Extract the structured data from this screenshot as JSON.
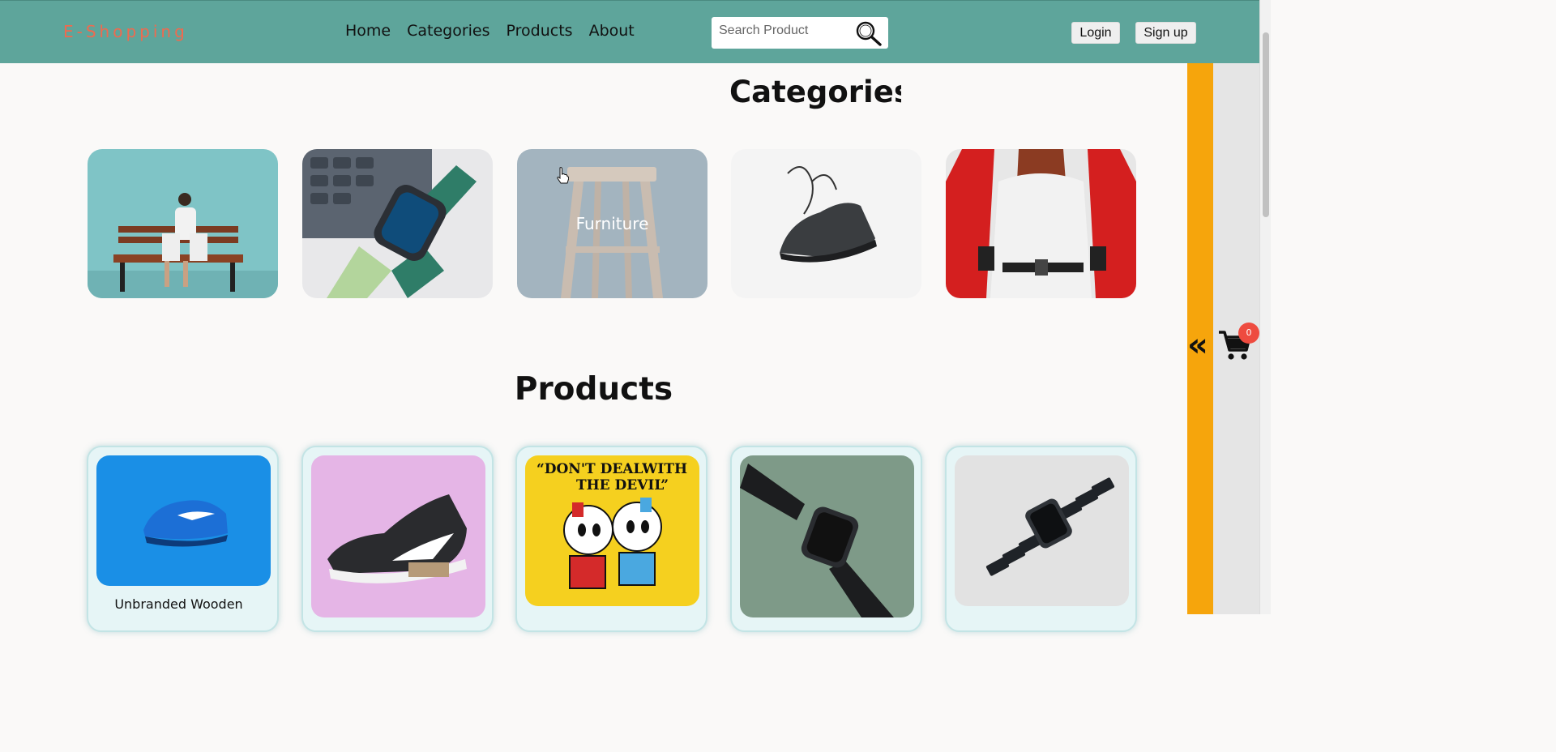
{
  "header": {
    "brand": "E-Shopping",
    "nav": [
      "Home",
      "Categories",
      "Products",
      "About"
    ],
    "search_placeholder": "Search Product",
    "login_label": "Login",
    "signup_label": "Sign up"
  },
  "categories_section": {
    "title": "Categories",
    "hover_label": "Furniture"
  },
  "products_section": {
    "title": "Products",
    "first_product_name": "Unbranded Wooden"
  },
  "cart": {
    "count": "0",
    "toggle": "«"
  },
  "colors": {
    "navbar": "#5ea59b",
    "brand": "#ef6a4f",
    "side_bar": "#f6a50c",
    "badge": "#ee4b3f"
  }
}
